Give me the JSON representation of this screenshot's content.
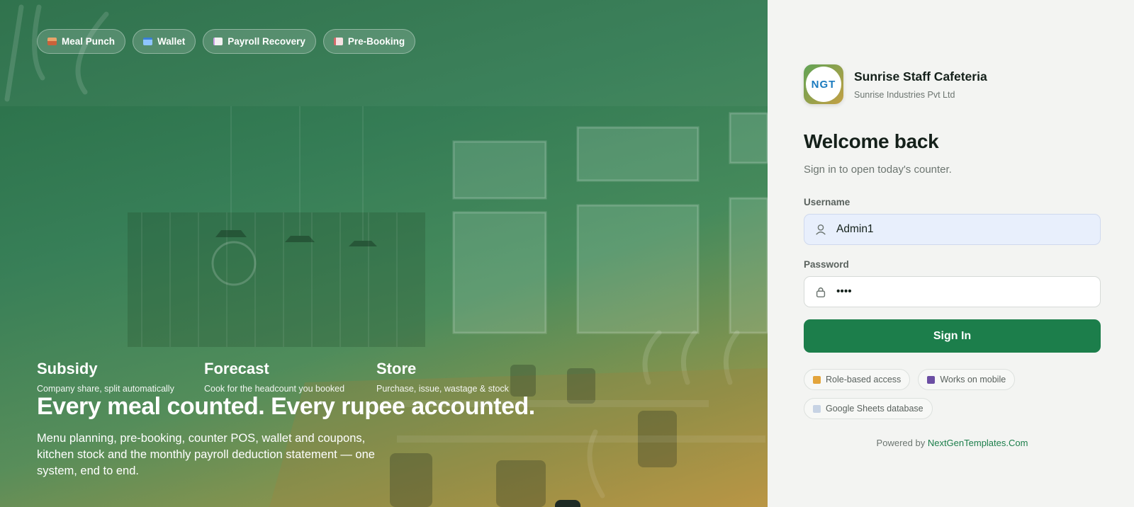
{
  "hero": {
    "chips": [
      {
        "label": "Meal Punch",
        "icon": "bowl-icon"
      },
      {
        "label": "Wallet",
        "icon": "wallet-icon"
      },
      {
        "label": "Payroll Recovery",
        "icon": "receipt-icon"
      },
      {
        "label": "Pre-Booking",
        "icon": "notebook-icon"
      }
    ],
    "stats": [
      {
        "title": "Subsidy",
        "subtitle": "Company share, split automatically"
      },
      {
        "title": "Forecast",
        "subtitle": "Cook for the headcount you booked"
      },
      {
        "title": "Store",
        "subtitle": "Purchase, issue, wastage & stock"
      }
    ],
    "headline": "Every meal counted. Every rupee accounted.",
    "description": "Menu planning, pre-booking, counter POS, wallet and coupons, kitchen stock and the monthly payroll deduction statement — one system, end to end."
  },
  "brand": {
    "logo_text": "NGT",
    "name": "Sunrise Staff Cafeteria",
    "company": "Sunrise Industries Pvt Ltd"
  },
  "login": {
    "title": "Welcome back",
    "subtitle": "Sign in to open today's counter.",
    "username_label": "Username",
    "username_value": "Admin1",
    "password_label": "Password",
    "password_value": "••••",
    "signin_label": "Sign In"
  },
  "features": [
    {
      "label": "Role-based access",
      "icon": "lock-icon"
    },
    {
      "label": "Works on mobile",
      "icon": "phone-icon"
    },
    {
      "label": "Google Sheets database",
      "icon": "cloud-icon"
    }
  ],
  "footer": {
    "powered_prefix": "Powered by",
    "powered_link": "NextGenTemplates.Com"
  },
  "colors": {
    "accent": "#1c7e4b",
    "panel_bg": "#f3f4f2",
    "input_active_bg": "#e8effc"
  }
}
